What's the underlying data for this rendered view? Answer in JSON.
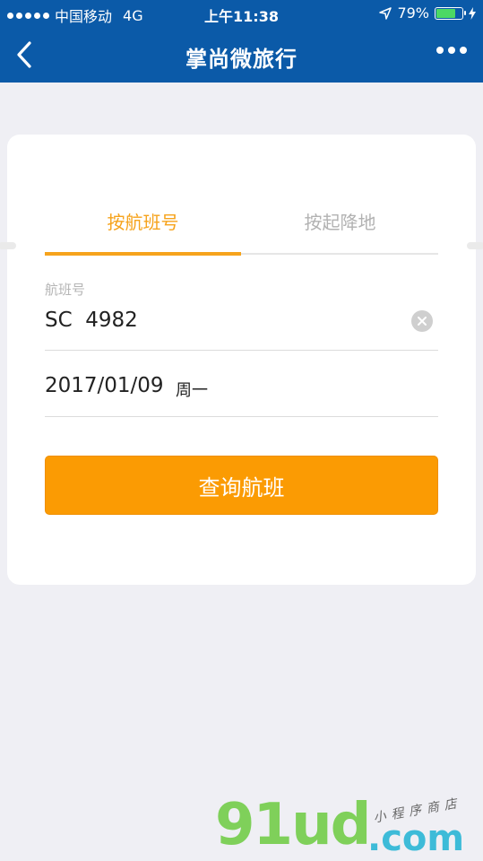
{
  "status_bar": {
    "carrier": "中国移动",
    "network": "4G",
    "time": "上午11:38",
    "battery_text": "79%",
    "battery_level": 0.79
  },
  "nav": {
    "title": "掌尚微旅行",
    "back_icon": "chevron-left-icon",
    "more_icon": "more-dots-icon"
  },
  "tabs": [
    {
      "label": "按航班号",
      "active": true
    },
    {
      "label": "按起降地",
      "active": false
    }
  ],
  "form": {
    "flight_label": "航班号",
    "flight_value": "SC  4982",
    "date_value": "2017/01/09",
    "weekday_value": "周一"
  },
  "search_button": "查询航班",
  "watermark": {
    "main": "91ud",
    "com": ".com",
    "sub": "小程序商店"
  },
  "colors": {
    "brand_blue": "#0b5aa8",
    "accent_orange": "#fb9b03",
    "tab_active": "#f6a31c",
    "background": "#efeff4"
  }
}
